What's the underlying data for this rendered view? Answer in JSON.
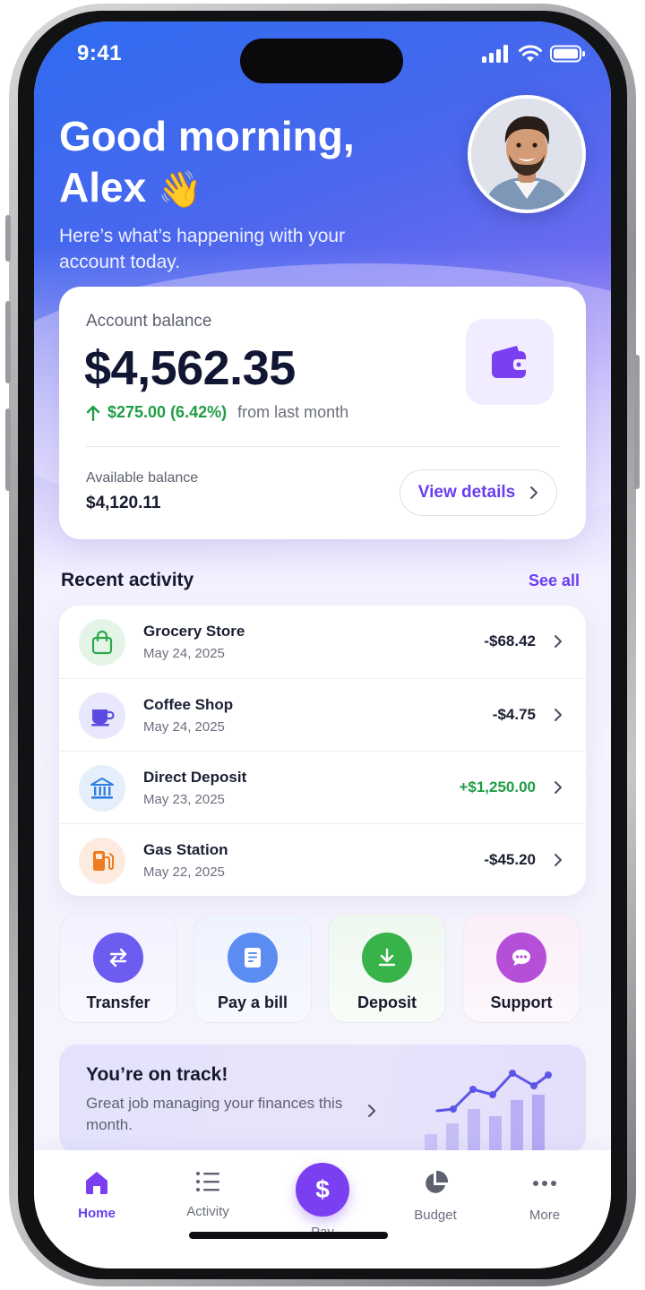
{
  "status_bar": {
    "time": "9:41"
  },
  "greeting": {
    "title_line1": "Good morning,",
    "title_line2": "Alex",
    "emoji": "👋",
    "subtitle": "Here’s what’s happening with your account today."
  },
  "balance": {
    "label": "Account balance",
    "value": "$4,562.35",
    "change_amount": "$275.00 (6.42%)",
    "change_note": "from last month",
    "available_label": "Available balance",
    "available_value": "$4,120.11",
    "view_details_label": "View details",
    "icon": "wallet-icon"
  },
  "recent_activity": {
    "title": "Recent activity",
    "see_all": "See all",
    "items": [
      {
        "name": "Grocery Store",
        "date": "May 24, 2025",
        "amount": "-$68.42",
        "icon": "shopping-bag-icon",
        "color": "#2aa84a"
      },
      {
        "name": "Coffee Shop",
        "date": "May 24, 2025",
        "amount": "-$4.75",
        "icon": "coffee-cup-icon",
        "color": "#5b4be0"
      },
      {
        "name": "Direct Deposit",
        "date": "May 23, 2025",
        "amount": "+$1,250.00",
        "icon": "bank-icon",
        "color": "#2f7de0"
      },
      {
        "name": "Gas Station",
        "date": "May 22, 2025",
        "amount": "-$45.20",
        "icon": "fuel-pump-icon",
        "color": "#f07a1f"
      }
    ]
  },
  "quick_actions": [
    {
      "label": "Transfer",
      "icon": "transfer-arrows-icon",
      "color": "#6c5cf0"
    },
    {
      "label": "Pay a bill",
      "icon": "bill-icon",
      "color": "#5b8cf2"
    },
    {
      "label": "Deposit",
      "icon": "download-icon",
      "color": "#37b34a"
    },
    {
      "label": "Support",
      "icon": "chat-bubble-icon",
      "color": "#b64fd8"
    }
  ],
  "track": {
    "title": "You’re on track!",
    "subtitle": "Great job managing your finances this month."
  },
  "bottom_nav": {
    "home": "Home",
    "activity": "Activity",
    "pay": "Pay",
    "pay_symbol": "$",
    "budget": "Budget",
    "more": "More"
  },
  "colors": {
    "accent": "#6a3df0",
    "positive": "#1f9d45"
  }
}
